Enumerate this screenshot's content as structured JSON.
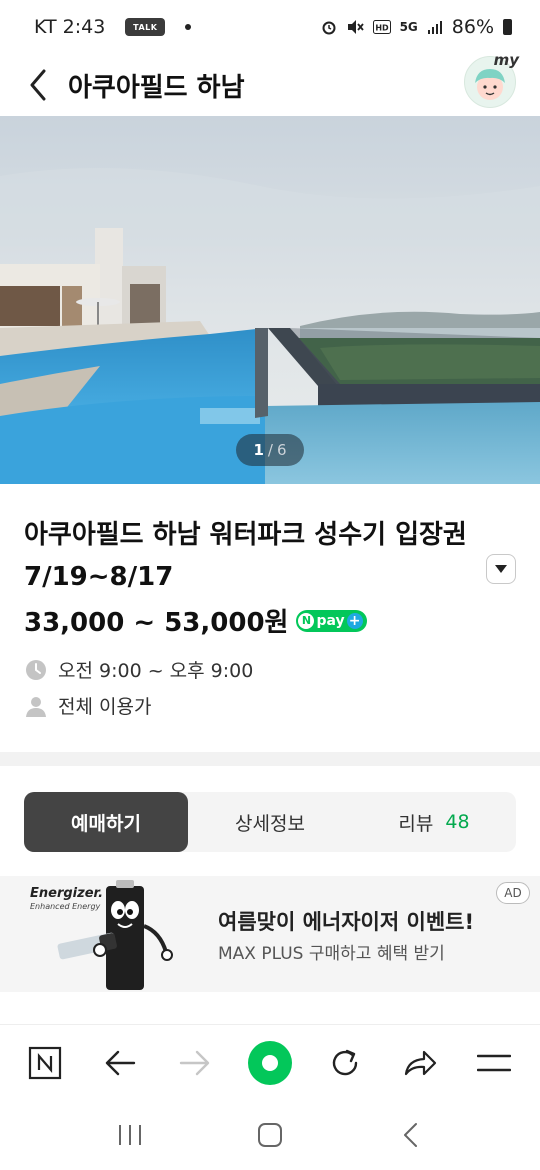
{
  "status_bar": {
    "carrier_time": "KT 2:43",
    "talk_badge": "TALK",
    "network": "5G",
    "battery": "86%"
  },
  "header": {
    "title": "아쿠아필드 하남",
    "avatar_label": "my"
  },
  "gallery": {
    "current": "1",
    "separator": "/",
    "total": "6"
  },
  "product": {
    "title": "아쿠아필드 하남 워터파크 성수기 입장권7/19~8/17",
    "price": "33,000 ~ 53,000원",
    "npay_label": "pay",
    "npay_n": "N",
    "npay_plus": "+",
    "hours": "오전 9:00 ~ 오후 9:00",
    "audience": "전체 이용가"
  },
  "tabs": [
    {
      "label": "예매하기",
      "active": true
    },
    {
      "label": "상세정보",
      "active": false
    },
    {
      "label": "리뷰",
      "count": "48",
      "active": false
    }
  ],
  "ad": {
    "brand": "Energizer.",
    "brand_sub": "Enhanced Energy",
    "title": "여름맞이 에너자이저 이벤트!",
    "subtitle": "MAX PLUS 구매하고 혜택 받기",
    "badge": "AD",
    "battery_text": "Energizer"
  },
  "browser_toolbar": {
    "home_letter": "N"
  },
  "colors": {
    "accent_green": "#03c75a",
    "tab_active": "#444444",
    "review_count": "#03a94e"
  }
}
